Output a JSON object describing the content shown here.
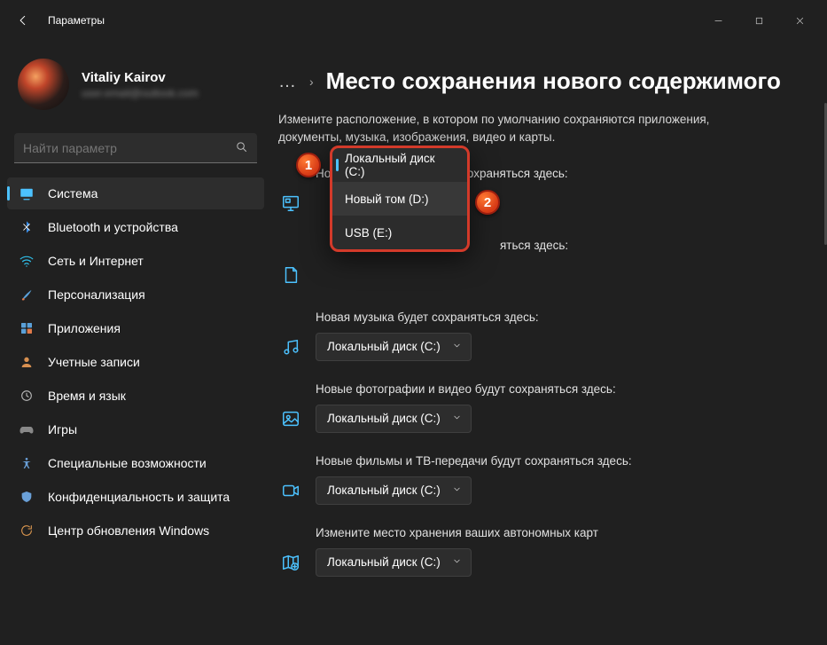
{
  "window": {
    "title": "Параметры"
  },
  "user": {
    "name": "Vitaliy Kairov",
    "email": "user.email@outlook.com"
  },
  "search": {
    "placeholder": "Найти параметр"
  },
  "nav": [
    {
      "key": "system",
      "label": "Система",
      "active": true
    },
    {
      "key": "bluetooth",
      "label": "Bluetooth и устройства",
      "active": false
    },
    {
      "key": "network",
      "label": "Сеть и Интернет",
      "active": false
    },
    {
      "key": "personalize",
      "label": "Персонализация",
      "active": false
    },
    {
      "key": "apps",
      "label": "Приложения",
      "active": false
    },
    {
      "key": "accounts",
      "label": "Учетные записи",
      "active": false
    },
    {
      "key": "timelang",
      "label": "Время и язык",
      "active": false
    },
    {
      "key": "gaming",
      "label": "Игры",
      "active": false
    },
    {
      "key": "accessibility",
      "label": "Специальные возможности",
      "active": false
    },
    {
      "key": "privacy",
      "label": "Конфиденциальность и защита",
      "active": false
    },
    {
      "key": "update",
      "label": "Центр обновления Windows",
      "active": false
    }
  ],
  "breadcrumb": {
    "more": "…",
    "sep": "›",
    "title": "Место сохранения нового содержимого"
  },
  "description": "Измените расположение, в котором по умолчанию сохраняются приложения, документы, музыка, изображения, видео и карты.",
  "defaultDisk": "Локальный диск (C:)",
  "sections": {
    "apps": {
      "label": "Новые приложения будут сохраняться здесь:"
    },
    "docs": {
      "label_suffix": "яться здесь:"
    },
    "music": {
      "label": "Новая музыка будет сохраняться здесь:"
    },
    "photos": {
      "label": "Новые фотографии и видео будут сохраняться здесь:"
    },
    "movies": {
      "label": "Новые фильмы и ТВ-передачи будут сохраняться здесь:"
    },
    "maps": {
      "label": "Измените место хранения ваших автономных карт"
    }
  },
  "dropdown_options": [
    "Локальный диск (C:)",
    "Новый том (D:)",
    "USB (E:)"
  ],
  "annotations": {
    "badge1": "1",
    "badge2": "2"
  }
}
